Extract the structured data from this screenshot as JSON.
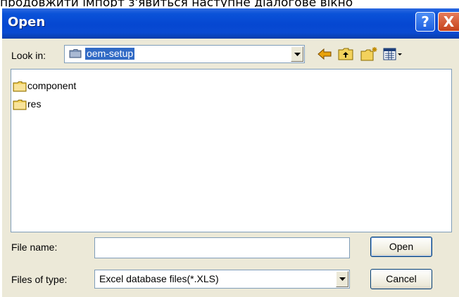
{
  "page": {
    "caption": "продовжити імпорт з'явиться наступне діалогове вікно"
  },
  "window": {
    "title": "Open",
    "help_glyph": "?",
    "close_glyph": "X"
  },
  "lookin": {
    "label": "Look in:",
    "value": "oem-setup"
  },
  "toolbar": {
    "icons": [
      "back-arrow-icon",
      "up-folder-icon",
      "new-folder-icon",
      "view-menu-icon"
    ]
  },
  "files": [
    {
      "name": "component",
      "icon": "folder-icon"
    },
    {
      "name": "res",
      "icon": "folder-icon"
    }
  ],
  "filename": {
    "label": "File name:",
    "value": ""
  },
  "filetype": {
    "label": "Files of type:",
    "value": "Excel database files(*.XLS)"
  },
  "buttons": {
    "open": "Open",
    "cancel": "Cancel"
  },
  "colors": {
    "titlebar": "#0a52d8",
    "selection": "#316ac5",
    "dialog_bg": "#ece9d8",
    "close_button": "#c5431b"
  }
}
